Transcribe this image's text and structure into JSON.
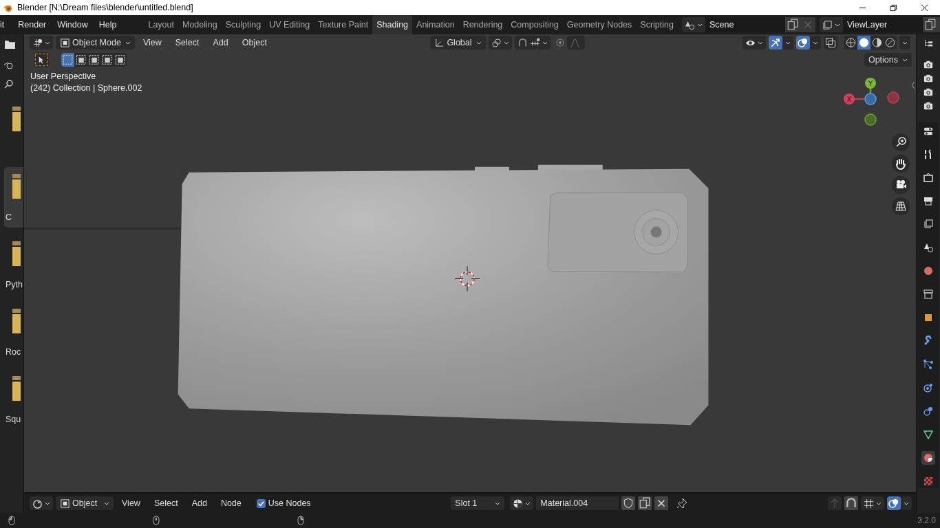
{
  "window": {
    "title": "Blender [N:\\Dream files\\blender\\untitled.blend]"
  },
  "menu": [
    "it",
    "Render",
    "Window",
    "Help"
  ],
  "workspaces": [
    {
      "label": "Layout",
      "selected": false
    },
    {
      "label": "Modeling",
      "selected": false
    },
    {
      "label": "Sculpting",
      "selected": false
    },
    {
      "label": "UV Editing",
      "selected": false
    },
    {
      "label": "Texture Paint",
      "selected": false
    },
    {
      "label": "Shading",
      "selected": true
    },
    {
      "label": "Animation",
      "selected": false
    },
    {
      "label": "Rendering",
      "selected": false
    },
    {
      "label": "Compositing",
      "selected": false
    },
    {
      "label": "Geometry Nodes",
      "selected": false
    },
    {
      "label": "Scripting",
      "selected": false
    }
  ],
  "scene": {
    "value": "Scene"
  },
  "view_layer": {
    "value": "ViewLayer"
  },
  "file_browser": {
    "items": [
      {
        "selected": false
      },
      {
        "label": "C",
        "selected": true
      },
      {
        "label": "Pyth",
        "selected": false
      },
      {
        "label": "Roc",
        "selected": false
      },
      {
        "label": "Squ",
        "selected": false
      }
    ]
  },
  "viewport": {
    "mode": "Object Mode",
    "menus": [
      "View",
      "Select",
      "Add",
      "Object"
    ],
    "orientation": "Global",
    "snap_on": false,
    "proportional_editing_on": false,
    "gizmos_on": true,
    "overlays_on": true,
    "shading_modes": [
      {
        "selected": false
      },
      {
        "selected": true
      },
      {
        "selected": false
      },
      {
        "selected": false
      }
    ],
    "select_modes": [
      {
        "selected": true
      },
      {
        "selected": false
      },
      {
        "selected": false
      },
      {
        "selected": false
      },
      {
        "selected": false
      }
    ],
    "options": "Options",
    "info": [
      "User Perspective",
      "(242) Collection | Sphere.002"
    ],
    "gizmo": {
      "x": "X",
      "y": "Y"
    }
  },
  "properties_tabs": [
    {
      "kind": "tool",
      "selected": false
    },
    {
      "kind": "render",
      "selected": false
    },
    {
      "kind": "output",
      "selected": false
    },
    {
      "kind": "view_layer",
      "selected": false
    },
    {
      "kind": "scene",
      "selected": false
    },
    {
      "kind": "world",
      "selected": false
    },
    {
      "kind": "collection",
      "selected": false
    },
    {
      "kind": "object",
      "selected": false
    },
    {
      "kind": "modifiers",
      "selected": false
    },
    {
      "kind": "particles",
      "selected": false
    },
    {
      "kind": "physics",
      "selected": false
    },
    {
      "kind": "constraints",
      "selected": false
    },
    {
      "kind": "data",
      "selected": false
    },
    {
      "kind": "material",
      "selected": true
    },
    {
      "kind": "texture",
      "selected": false
    }
  ],
  "node_header": {
    "object": "Object",
    "menus": [
      "View",
      "Select",
      "Add",
      "Node"
    ],
    "use_nodes": {
      "label": "Use Nodes",
      "checked": true
    },
    "slot": "Slot 1",
    "material": "Material.004"
  },
  "status_bar": {
    "version": "3.2.0"
  }
}
